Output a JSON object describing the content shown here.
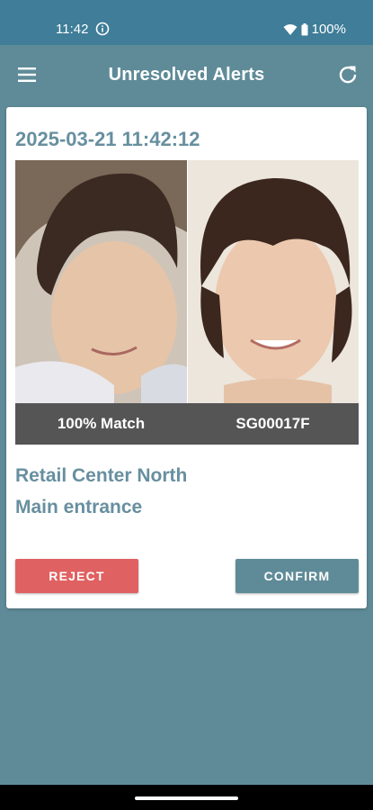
{
  "status_bar": {
    "time": "11:42",
    "battery": "100%"
  },
  "app_bar": {
    "title": "Unresolved Alerts"
  },
  "alert": {
    "timestamp": "2025-03-21 11:42:12",
    "match_label": "100% Match",
    "subject_id": "SG00017F",
    "site": "Retail Center North",
    "location": "Main entrance",
    "reject_label": "REJECT",
    "confirm_label": "CONFIRM"
  },
  "colors": {
    "status_bar": "#3f7d98",
    "app_bar": "#5f8b98",
    "accent_text": "#678f9f",
    "reject": "#e06161",
    "confirm": "#5f8b98",
    "match_bar": "#555555"
  }
}
